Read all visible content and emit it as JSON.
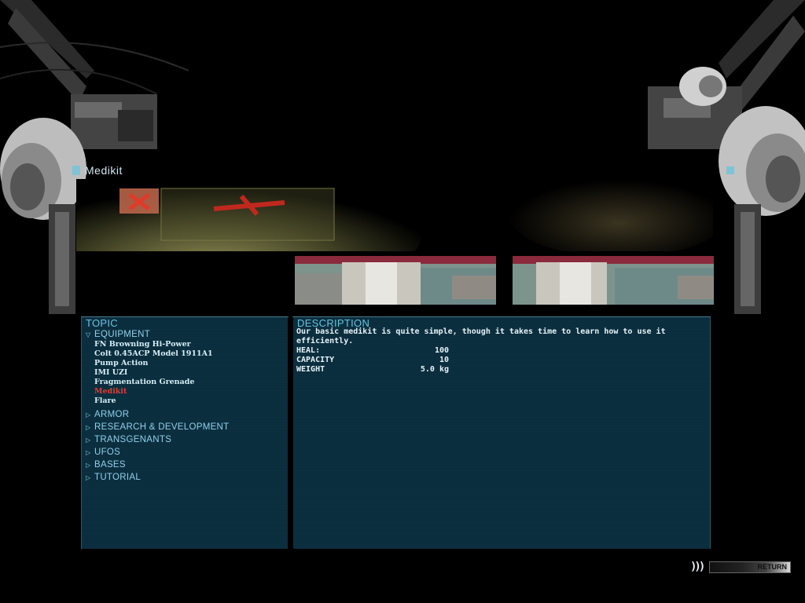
{
  "item_title": "Medikit",
  "caption": "",
  "topic": {
    "heading": "TOPIC",
    "categories": [
      {
        "label": "EQUIPMENT",
        "expanded": true,
        "items": [
          {
            "label": "FN Browning Hi-Power",
            "selected": false
          },
          {
            "label": "Colt 0.45ACP Model 1911A1",
            "selected": false
          },
          {
            "label": "Pump Action",
            "selected": false
          },
          {
            "label": "IMI UZI",
            "selected": false
          },
          {
            "label": "Fragmentation Grenade",
            "selected": false
          },
          {
            "label": "Medikit",
            "selected": true
          },
          {
            "label": "Flare",
            "selected": false
          }
        ]
      },
      {
        "label": "ARMOR",
        "expanded": false
      },
      {
        "label": "RESEARCH & DEVELOPMENT",
        "expanded": false
      },
      {
        "label": "TRANSGENANTS",
        "expanded": false
      },
      {
        "label": "UFOS",
        "expanded": false
      },
      {
        "label": "BASES",
        "expanded": false
      },
      {
        "label": "TUTORIAL",
        "expanded": false
      }
    ]
  },
  "description": {
    "heading": "DESCRIPTION",
    "text": "Our basic medikit is quite simple, though it takes time to learn how to use it efficiently.",
    "stats": [
      {
        "label": "HEAL:",
        "value": "100"
      },
      {
        "label": "CAPACITY",
        "value": "10"
      },
      {
        "label": "WEIGHT",
        "value": "5.0 kg"
      }
    ]
  },
  "return_button": {
    "label": "RETURN"
  },
  "colors": {
    "panel_bg": "#0c3142",
    "heading": "#69c2e3",
    "category": "#8fd0ea",
    "item": "#d6eef7",
    "selected_item": "#e23b34"
  },
  "icons": {
    "expanded": "triangle-down-icon",
    "collapsed": "triangle-right-icon",
    "return": "triple-chevron-icon"
  }
}
